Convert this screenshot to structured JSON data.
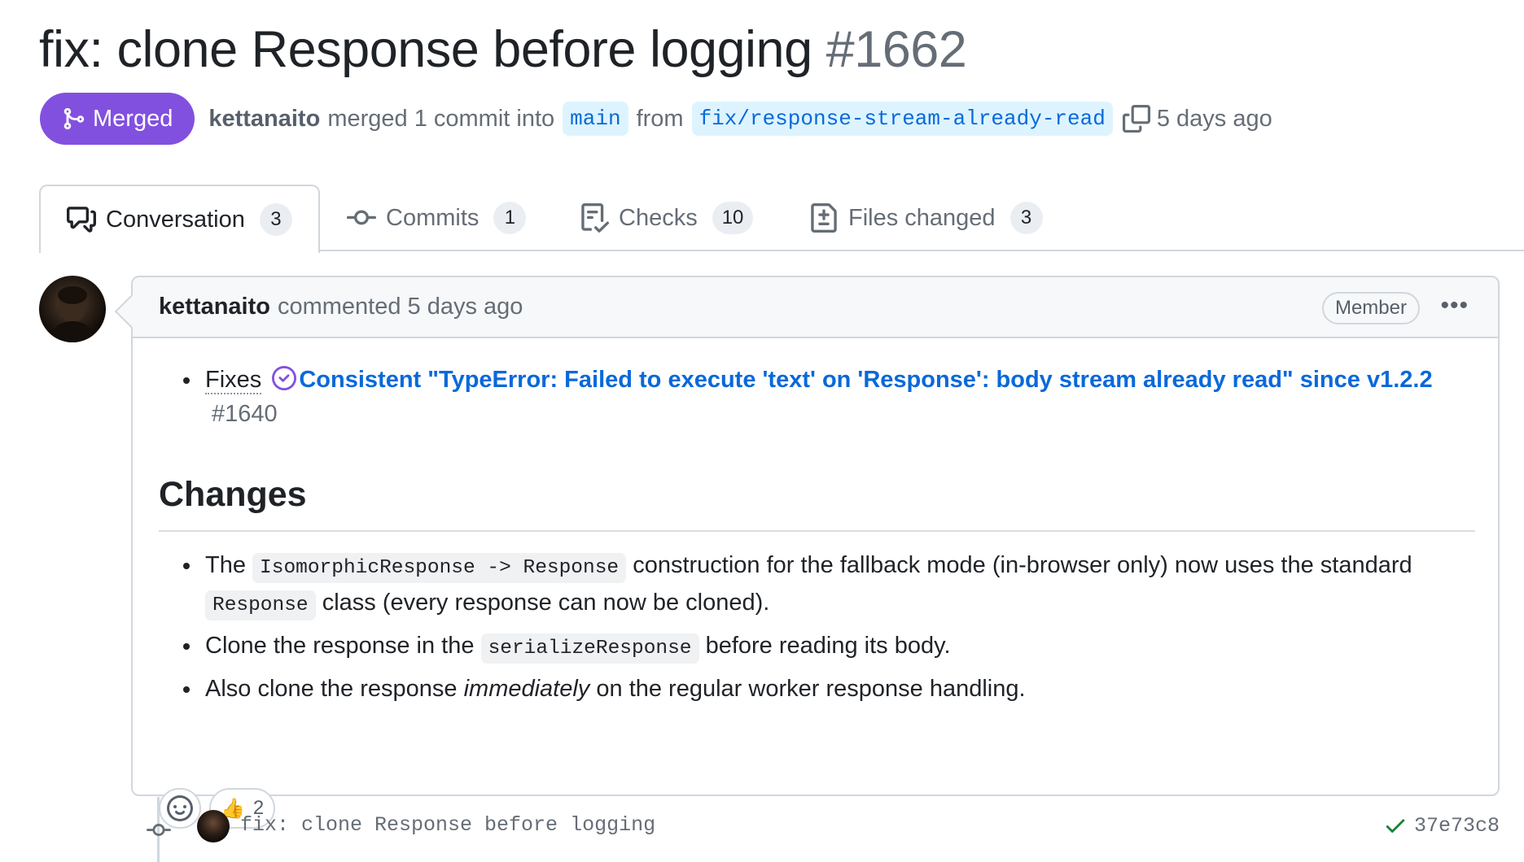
{
  "pr": {
    "title": "fix: clone Response before logging",
    "number": "#1662",
    "status_label": "Merged",
    "author": "kettanaito",
    "merge_text": "merged 1 commit into",
    "base_branch": "main",
    "from_text": "from",
    "head_branch": "fix/response-stream-already-read",
    "time": "5 days ago"
  },
  "tabs": [
    {
      "label": "Conversation",
      "count": "3"
    },
    {
      "label": "Commits",
      "count": "1"
    },
    {
      "label": "Checks",
      "count": "10"
    },
    {
      "label": "Files changed",
      "count": "3"
    }
  ],
  "comment": {
    "author": "kettanaito",
    "action": "commented 5 days ago",
    "role_badge": "Member",
    "fixes_label": "Fixes",
    "issue_title": "Consistent \"TypeError: Failed to execute 'text' on 'Response': body stream already read\" since v1.2.2",
    "issue_number": "#1640",
    "changes_heading": "Changes",
    "bullets": {
      "b1_pre": "The",
      "b1_code1": "IsomorphicResponse -> Response",
      "b1_mid": "construction for the fallback mode (in-browser only) now uses the standard",
      "b1_code2": "Response",
      "b1_post": "class (every response can now be cloned).",
      "b2_pre": "Clone the response in the",
      "b2_code": "serializeResponse",
      "b2_post": "before reading its body.",
      "b3_pre": "Also clone the response",
      "b3_em": "immediately",
      "b3_post": "on the regular worker response handling."
    },
    "reactions": {
      "thumbs_up_emoji": "👍",
      "thumbs_up_count": "2"
    }
  },
  "commit": {
    "message": "fix: clone Response before logging",
    "sha": "37e73c8"
  },
  "colors": {
    "merged": "#8250df",
    "link": "#0969da",
    "muted": "#656d76",
    "success": "#1a7f37"
  }
}
